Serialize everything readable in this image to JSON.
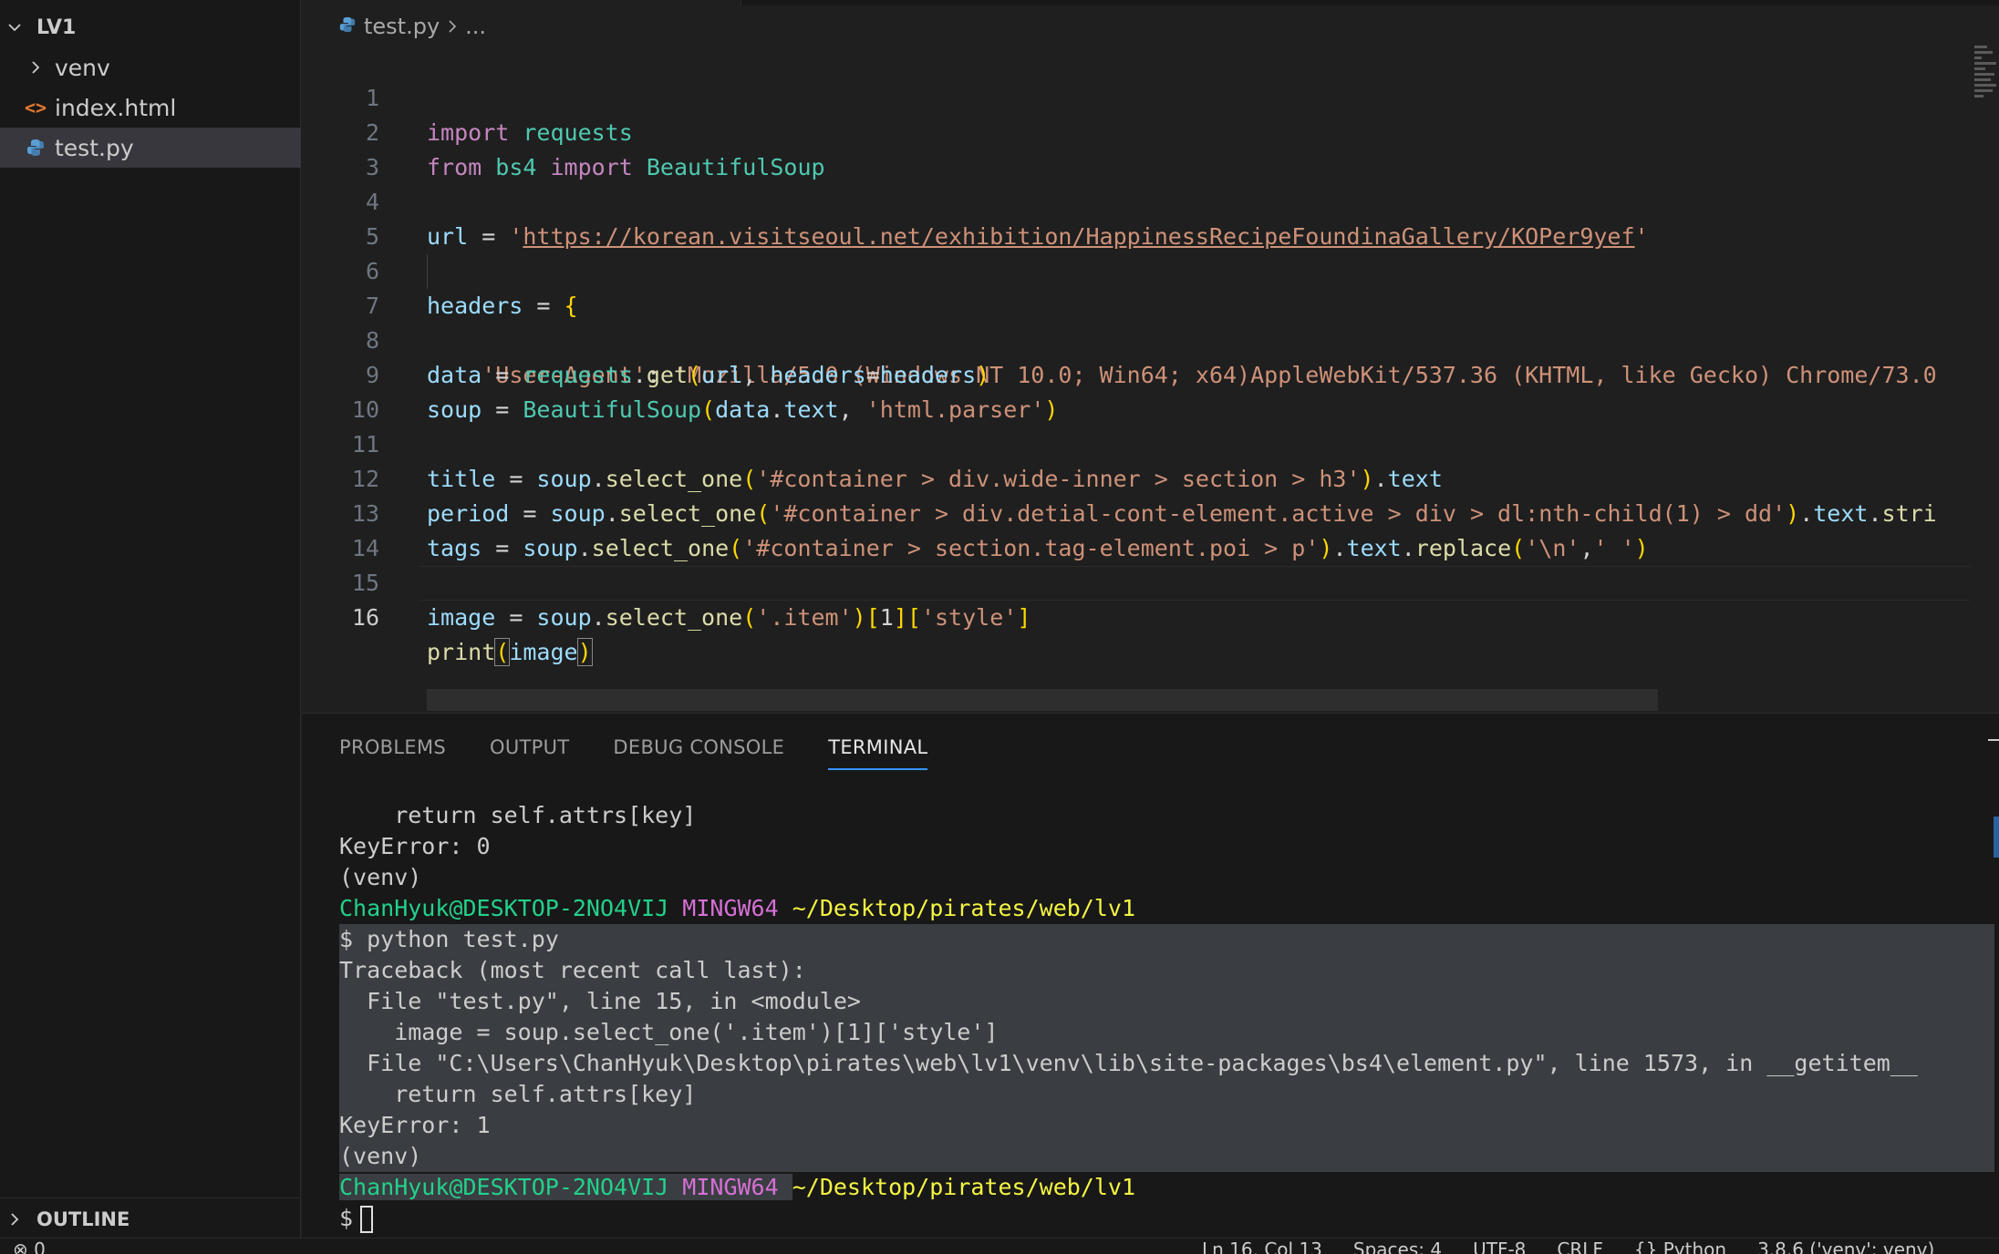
{
  "explorer": {
    "folder": "LV1",
    "items": [
      {
        "label": "venv",
        "type": "folder",
        "icon": "chevron-right-icon"
      },
      {
        "label": "index.html",
        "type": "file",
        "icon": "html-file-icon"
      },
      {
        "label": "test.py",
        "type": "file",
        "icon": "python-file-icon",
        "selected": true
      }
    ],
    "outline": "OUTLINE"
  },
  "editor": {
    "breadcrumb": {
      "file": "test.py",
      "rest": "..."
    },
    "current_line": 16,
    "lines": {
      "l1": {
        "n": "1",
        "kw": "import",
        "mod": "requests"
      },
      "l2": {
        "n": "2",
        "kw1": "from",
        "mod": "bs4",
        "kw2": "import",
        "cls": "BeautifulSoup"
      },
      "l3": {
        "n": "3"
      },
      "l4": {
        "n": "4",
        "var": "url",
        "op": " = ",
        "q1": "'",
        "url": "https://korean.visitseoul.net/exhibition/HappinessRecipeFoundinaGallery/KOPer9yef",
        "q2": "'"
      },
      "l5": {
        "n": "5"
      },
      "l6": {
        "n": "6",
        "var": "headers",
        "op": " = ",
        "br": "{"
      },
      "l7": {
        "n": "7",
        "key": "'User-Agent'",
        "colon": ": ",
        "val": "'Mozilla/5.0 (Windows NT 10.0; Win64; x64)AppleWebKit/537.36 (KHTML, like Gecko) Chrome/73.0"
      },
      "l8": {
        "n": "8",
        "var": "data",
        "op": " = ",
        "obj": "requests",
        "dot": ".",
        "fn": "get",
        "open": "(",
        "a1": "url",
        "comma": ", ",
        "a2": "headers",
        "eq": "=",
        "a3": "headers",
        "close": ")"
      },
      "l9": {
        "n": "9",
        "var": "soup",
        "op": " = ",
        "cls": "BeautifulSoup",
        "open": "(",
        "a1": "data",
        "dot": ".",
        "a2": "text",
        "comma": ", ",
        "str": "'html.parser'",
        "close": ")"
      },
      "l10": {
        "n": "10"
      },
      "l11": {
        "n": "11",
        "var": "title",
        "op": " = ",
        "obj": "soup",
        "dot": ".",
        "fn": "select_one",
        "open": "(",
        "str": "'#container > div.wide-inner > section > h3'",
        "close": ")",
        "dot2": ".",
        "attr": "text"
      },
      "l12": {
        "n": "12",
        "var": "period",
        "op": " = ",
        "obj": "soup",
        "dot": ".",
        "fn": "select_one",
        "open": "(",
        "str": "'#container > div.detial-cont-element.active > div > dl:nth-child(1) > dd'",
        "close": ")",
        "dot2": ".",
        "attr": "text",
        "dot3": ".",
        "fn2": "stri"
      },
      "l13": {
        "n": "13",
        "var": "tags",
        "op": " = ",
        "obj": "soup",
        "dot": ".",
        "fn": "select_one",
        "open": "(",
        "str": "'#container > section.tag-element.poi > p'",
        "close": ")",
        "dot2": ".",
        "attr": "text",
        "dot3": ".",
        "fn2": "replace",
        "open2": "(",
        "s2": "'\\n'",
        "comma": ",",
        "s3": "' '",
        "close2": ")"
      },
      "l14": {
        "n": "14"
      },
      "l15": {
        "n": "15",
        "var": "image",
        "op": " = ",
        "obj": "soup",
        "dot": ".",
        "fn": "select_one",
        "open": "(",
        "str": "'.item'",
        "close": ")",
        "idx1o": "[",
        "idx1": "1",
        "idx1c": "]",
        "idx2o": "[",
        "idx2": "'style'",
        "idx2c": "]"
      },
      "l16": {
        "n": "16",
        "fn": "print",
        "open": "(",
        "arg": "image",
        "close": ")"
      }
    }
  },
  "panel": {
    "tabs": [
      "PROBLEMS",
      "OUTPUT",
      "DEBUG CONSOLE",
      "TERMINAL"
    ],
    "active_tab": "TERMINAL",
    "terminal": {
      "t1": "    return self.attrs[key]",
      "t2": "KeyError: 0",
      "t3": "(venv)",
      "p1": {
        "user": "ChanHyuk@DESKTOP-2NO4VIJ",
        "sys": "MINGW64",
        "path": "~/Desktop/pirates/web/lv1"
      },
      "t4": "$ python test.py",
      "t5": "Traceback (most recent call last):",
      "t6": "  File \"test.py\", line 15, in <module>",
      "t7": "    image = soup.select_one('.item')[1]['style']",
      "t8": "  File \"C:\\Users\\ChanHyuk\\Desktop\\pirates\\web\\lv1\\venv\\lib\\site-packages\\bs4\\element.py\", line 1573, in __getitem__",
      "t9": "    return self.attrs[key]",
      "t10": "KeyError: 1",
      "t11": "(venv)",
      "p2": {
        "user": "ChanHyuk@DESKTOP-2NO4VIJ",
        "sys": "MINGW64",
        "path": "~/Desktop/pirates/web/lv1"
      },
      "prompt": "$"
    }
  },
  "statusbar": {
    "left": "⊗ 0",
    "position": "Ln 16, Col 13",
    "spaces": "Spaces: 4",
    "encoding": "UTF-8",
    "eol": "CRLF",
    "braces": "{}",
    "language": "Python",
    "interpreter": "3.8.6 ('venv': venv)"
  },
  "colors": {
    "keyword": "#c586c0",
    "module": "#4ec9b0",
    "variable": "#9cdcfe",
    "string": "#ce9178",
    "function": "#dcdcaa",
    "bracket": "#ffd700",
    "term_green": "#23d18b",
    "term_magenta": "#d670d6",
    "term_yellow": "#f5f543",
    "accent": "#3794ff"
  }
}
